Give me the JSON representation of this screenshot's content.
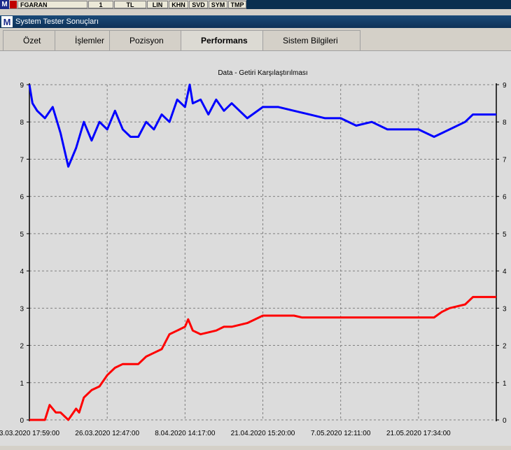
{
  "toolbar": {
    "symbol": "FGARAN",
    "quantity": "1",
    "currency": "TL",
    "buttons": [
      "LIN",
      "KHN",
      "SVD",
      "SYM",
      "TMP"
    ],
    "logo": "M"
  },
  "window": {
    "title": "System Tester Sonuçları",
    "logo": "M"
  },
  "tabs": [
    {
      "label": "Özet",
      "active": false
    },
    {
      "label": "İşlemler",
      "active": false
    },
    {
      "label": "Pozisyon",
      "active": false
    },
    {
      "label": "Performans",
      "active": true
    },
    {
      "label": "Sistem Bilgileri",
      "active": false
    }
  ],
  "chart_data": {
    "type": "line",
    "title": "Data - Getiri Karşılaştırılması",
    "ylim": [
      0,
      9
    ],
    "y_ticks": [
      0,
      1,
      2,
      3,
      4,
      5,
      6,
      7,
      8,
      9
    ],
    "x_tick_labels": [
      "3.03.2020 17:59:00",
      "26.03.2020 12:47:00",
      "8.04.2020 14:17:00",
      "21.04.2020 15:20:00",
      "7.05.2020 12:11:00",
      "21.05.2020 17:34:00"
    ],
    "x_tick_index": [
      0,
      5,
      10,
      15,
      20,
      25
    ],
    "x_max_index": 30,
    "grid": true,
    "series": [
      {
        "color": "#0000ff",
        "x": [
          0,
          0.2,
          0.5,
          1,
          1.5,
          2,
          2.5,
          3,
          3.5,
          4,
          4.5,
          5,
          5.5,
          6,
          6.5,
          7,
          7.5,
          8,
          8.5,
          9,
          9.5,
          10,
          10.3,
          10.5,
          11,
          11.5,
          12,
          12.5,
          13,
          14,
          15,
          16,
          17,
          18,
          19,
          20,
          21,
          22,
          23,
          24,
          25,
          26,
          27,
          28,
          28.5,
          29,
          30
        ],
        "values": [
          9.0,
          8.5,
          8.3,
          8.1,
          8.4,
          7.7,
          6.8,
          7.3,
          8.0,
          7.5,
          8.0,
          7.8,
          8.3,
          7.8,
          7.6,
          7.6,
          8.0,
          7.8,
          8.2,
          8.0,
          8.6,
          8.4,
          9.0,
          8.5,
          8.6,
          8.2,
          8.6,
          8.3,
          8.5,
          8.1,
          8.4,
          8.4,
          8.3,
          8.2,
          8.1,
          8.1,
          7.9,
          8.0,
          7.8,
          7.8,
          7.8,
          7.6,
          7.8,
          8.0,
          8.2,
          8.2,
          8.2
        ]
      },
      {
        "color": "#ff0000",
        "x": [
          0,
          1,
          1.3,
          1.7,
          2,
          2.5,
          3,
          3.2,
          3.5,
          4,
          4.5,
          5,
          5.5,
          6,
          6.5,
          7,
          7.5,
          8,
          8.5,
          9,
          9.5,
          10,
          10.2,
          10.5,
          11,
          12,
          12.5,
          13,
          14,
          15,
          16,
          17,
          17.5,
          18,
          20,
          22,
          22.5,
          23,
          24,
          25,
          26,
          26.5,
          27,
          28,
          28.5,
          29,
          30
        ],
        "values": [
          0,
          0,
          0.4,
          0.2,
          0.2,
          0,
          0.3,
          0.2,
          0.6,
          0.8,
          0.9,
          1.2,
          1.4,
          1.5,
          1.5,
          1.5,
          1.7,
          1.8,
          1.9,
          2.3,
          2.4,
          2.5,
          2.7,
          2.4,
          2.3,
          2.4,
          2.5,
          2.5,
          2.6,
          2.8,
          2.8,
          2.8,
          2.75,
          2.75,
          2.75,
          2.75,
          2.75,
          2.75,
          2.75,
          2.75,
          2.75,
          2.9,
          3.0,
          3.1,
          3.3,
          3.3,
          3.3
        ]
      }
    ]
  }
}
